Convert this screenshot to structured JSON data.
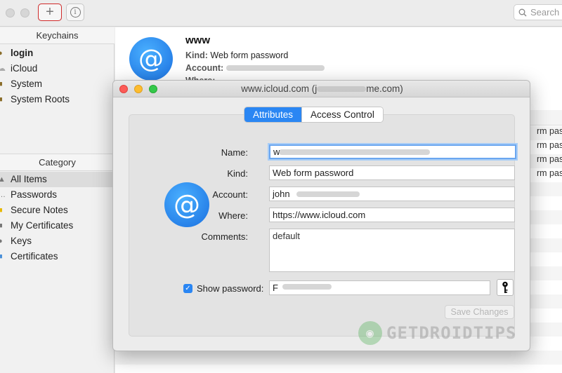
{
  "toolbar": {
    "add_label": "+",
    "info_label": "i",
    "search_placeholder": "Search"
  },
  "sidebar": {
    "keychains_header": "Keychains",
    "keychains": [
      "login",
      "iCloud",
      "System",
      "System Roots"
    ],
    "category_header": "Category",
    "categories": [
      "All Items",
      "Passwords",
      "Secure Notes",
      "My Certificates",
      "Keys",
      "Certificates"
    ]
  },
  "detail": {
    "title": "www",
    "kind_label": "Kind:",
    "kind_value": "Web form password",
    "account_label": "Account:",
    "where_label": "Where:"
  },
  "list": {
    "rows": [
      "rm passw",
      "rm passw",
      "rm passw",
      "rm passw"
    ]
  },
  "dialog": {
    "title": "www.icloud.com (j",
    "title_suffix": "me.com)",
    "tabs": [
      "Attributes",
      "Access Control"
    ],
    "name_label": "Name:",
    "name_value": "w",
    "kind_label": "Kind:",
    "kind_value": "Web form password",
    "account_label": "Account:",
    "account_value": "john",
    "where_label": "Where:",
    "where_value": "https://www.icloud.com",
    "comments_label": "Comments:",
    "comments_value": "default",
    "show_password_label": "Show password:",
    "password_value": "F",
    "save_label": "Save Changes"
  },
  "watermark": {
    "text": "GETDROIDTIPS"
  },
  "colors": {
    "accent": "#2a86f3",
    "close": "#fc5b57",
    "minimize": "#fdbc2e",
    "zoom": "#34c84a"
  }
}
